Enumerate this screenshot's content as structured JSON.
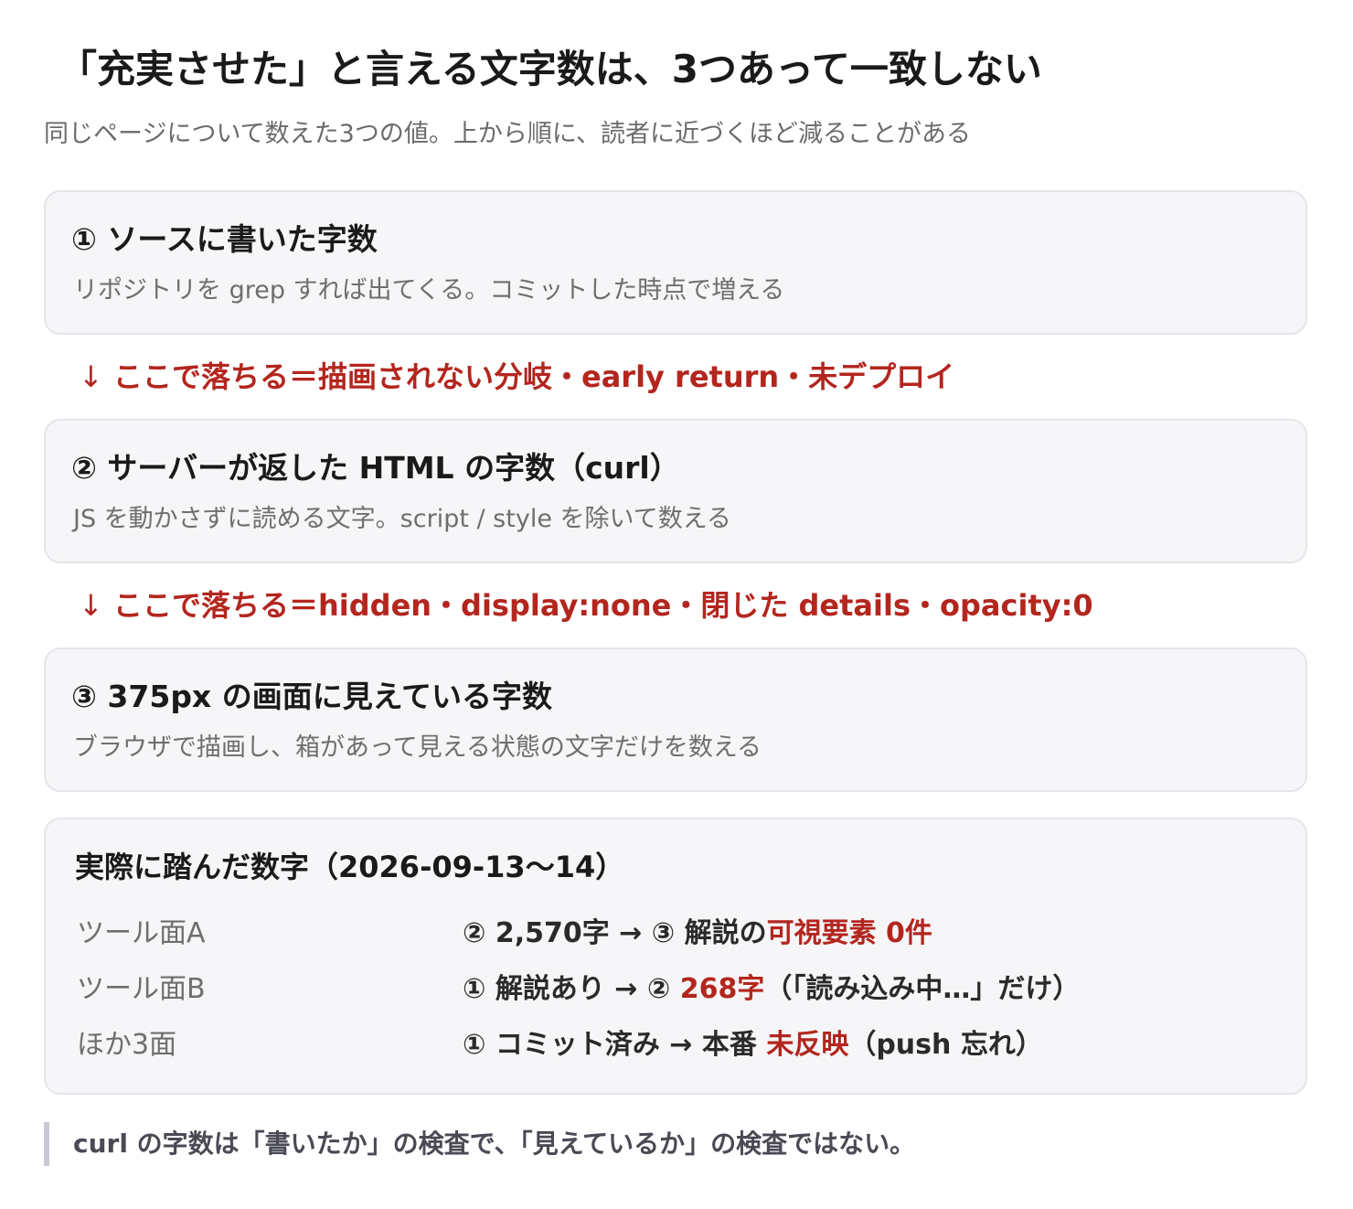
{
  "title": "「充実させた」と言える文字数は、3つあって一致しない",
  "subtitle": "同じページについて数えた3つの値。上から順に、読者に近づくほど減ることがある",
  "steps": [
    {
      "title": "① ソースに書いた字数",
      "desc": "リポジトリを grep すれば出てくる。コミットした時点で増える"
    },
    {
      "title": "② サーバーが返した HTML の字数（curl）",
      "desc": "JS を動かさずに読める文字。script / style を除いて数える"
    },
    {
      "title": "③ 375px の画面に見えている字数",
      "desc": "ブラウザで描画し、箱があって見える状態の文字だけを数える"
    }
  ],
  "drops": [
    {
      "arrow": "↓",
      "text": "ここで落ちる＝描画されない分岐・early return・未デプロイ"
    },
    {
      "arrow": "↓",
      "text": "ここで落ちる＝hidden・display:none・閉じた details・opacity:0"
    }
  ],
  "facts": {
    "title": "実際に踏んだ数字（2026-09-13〜14）",
    "rows": [
      {
        "label": "ツール面A",
        "pre": "② 2,570字 → ③ 解説の",
        "highlight": "可視要素 0件",
        "post": ""
      },
      {
        "label": "ツール面B",
        "pre": "① 解説あり → ② ",
        "highlight": "268字",
        "post": "（「読み込み中…」だけ）"
      },
      {
        "label": "ほか3面",
        "pre": "① コミット済み → 本番 ",
        "highlight": "未反映",
        "post": "（push 忘れ）"
      }
    ]
  },
  "quote": "curl の字数は「書いたか」の検査で、「見えているか」の検査ではない。",
  "colors": {
    "accent_red": "#b3261e",
    "card_bg": "#f6f6f8",
    "card_border": "#e4e4ea",
    "quote_bar": "#c8c8d4"
  }
}
